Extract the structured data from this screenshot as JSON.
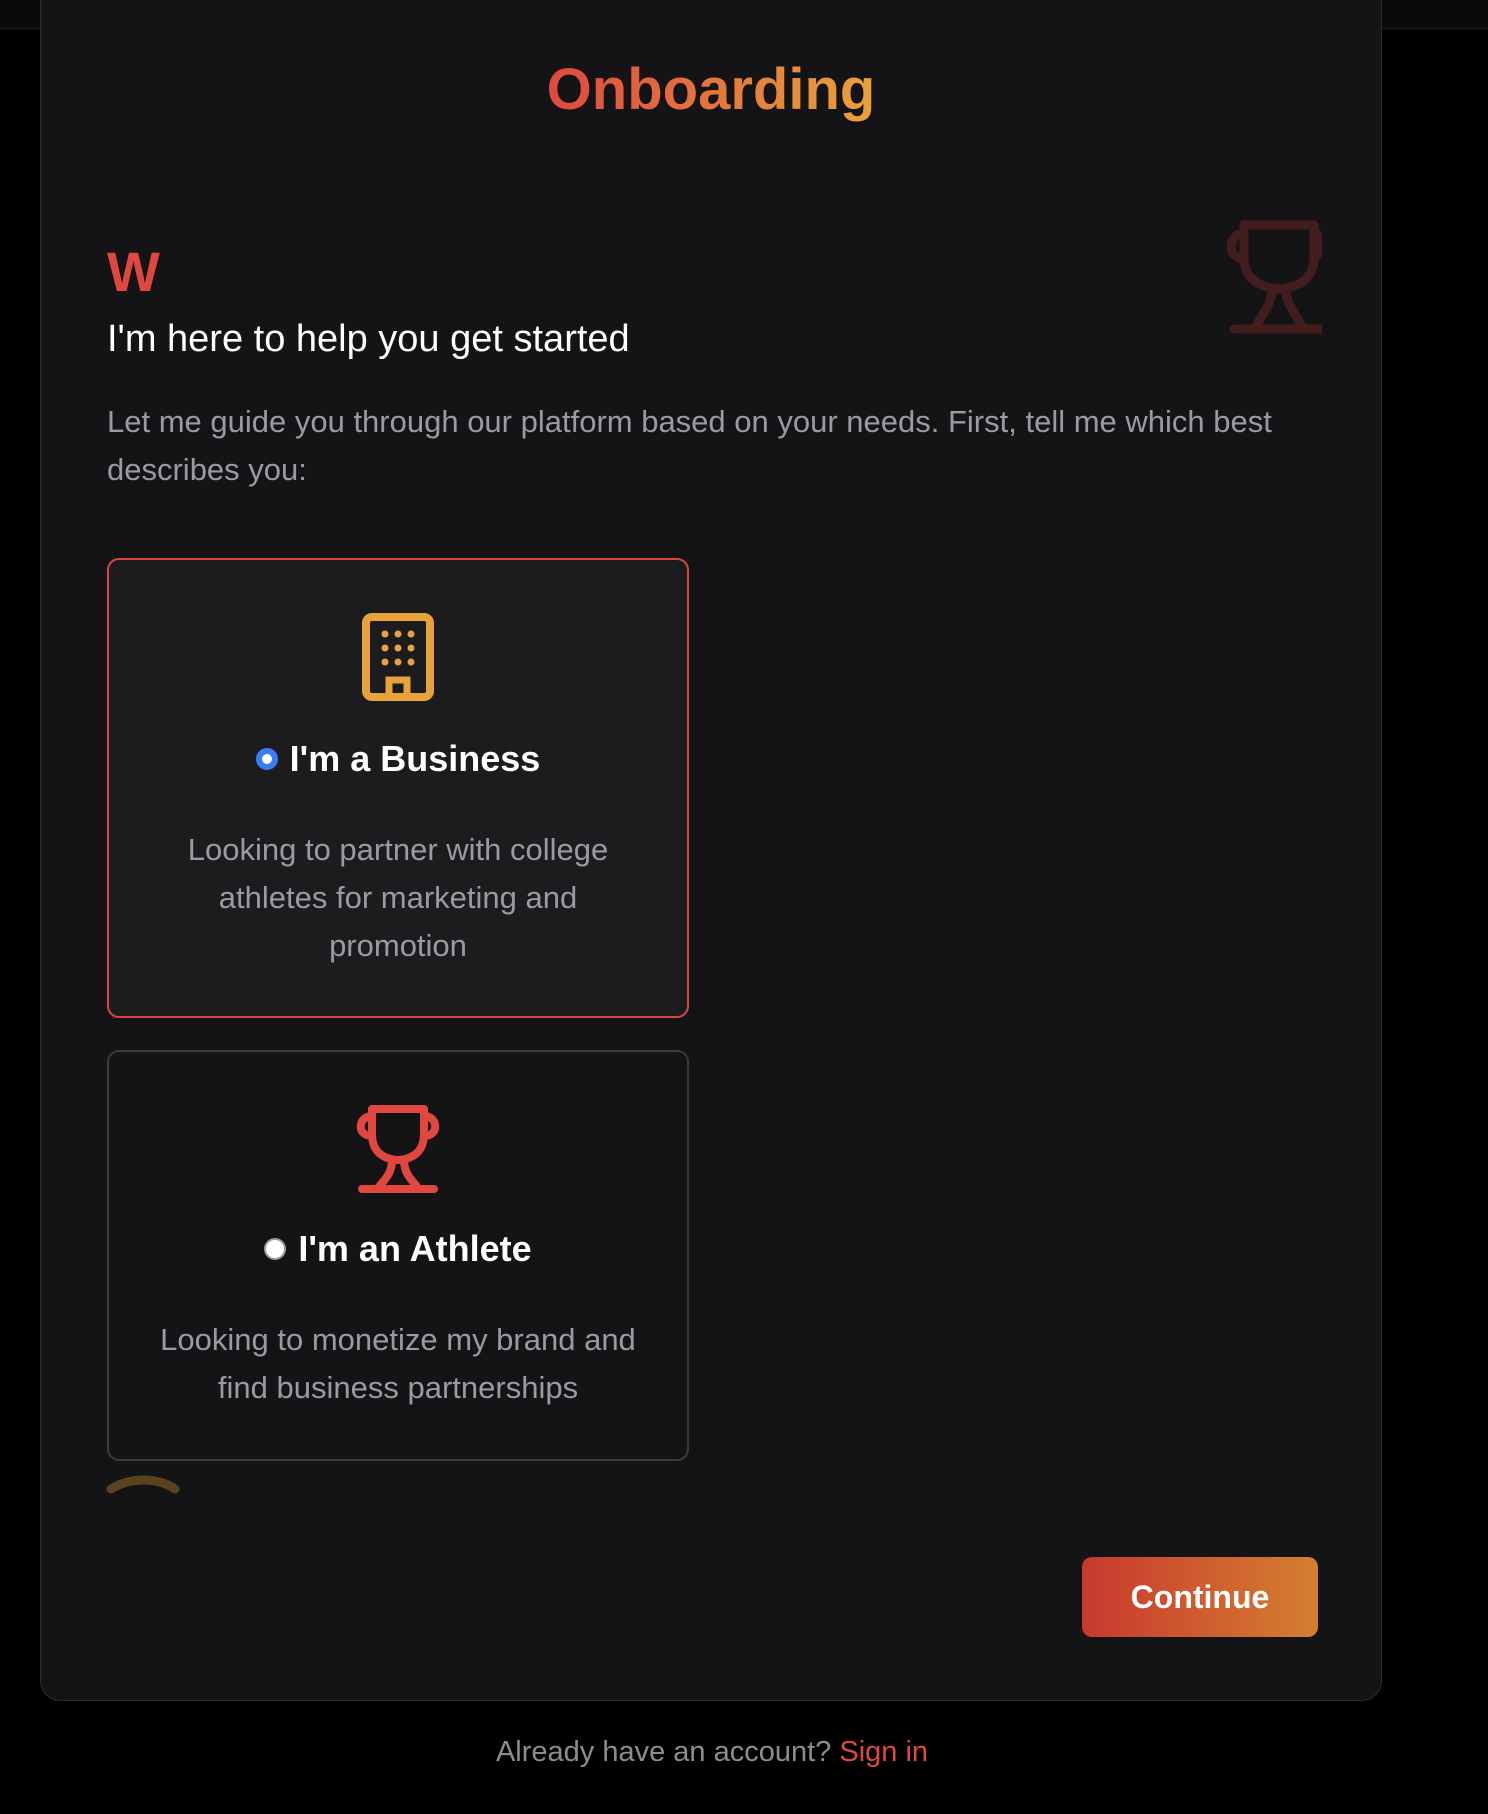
{
  "page": {
    "title": "Onboarding"
  },
  "intro": {
    "avatar_letter": "W",
    "subtitle": "I'm here to help you get started",
    "body": "Let me guide you through our platform based on your needs. First, tell me which best describes you:"
  },
  "options": [
    {
      "label": "I'm a Business",
      "description": "Looking to partner with college athletes for marketing and promotion",
      "icon": "building-icon",
      "selected": true
    },
    {
      "label": "I'm an Athlete",
      "description": "Looking to monetize my brand and find business partnerships",
      "icon": "trophy-icon",
      "selected": false
    }
  ],
  "actions": {
    "continue_label": "Continue"
  },
  "footer": {
    "prompt": "Already have an account?",
    "link_label": "Sign in"
  },
  "colors": {
    "accent_red": "#e0483f",
    "accent_orange": "#e8a23a",
    "radio_blue": "#3b7cf5",
    "background": "#141416"
  }
}
